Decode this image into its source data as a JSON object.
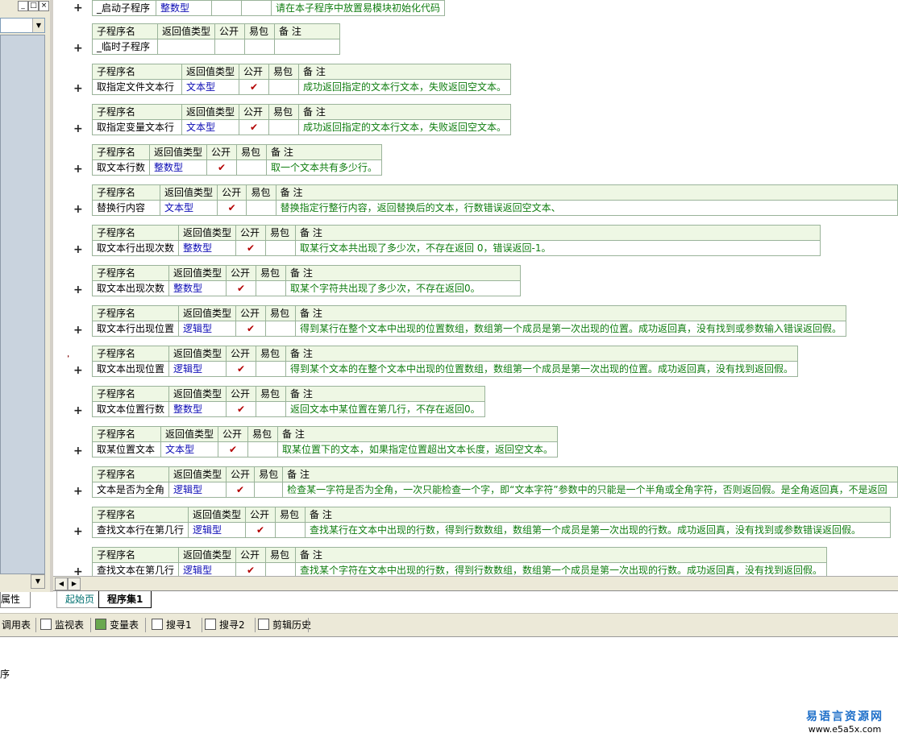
{
  "left_panel": {
    "btn_a": "_",
    "btn_b": "□",
    "btn_c": "×",
    "bottom_tab": "属性"
  },
  "top_row": {
    "name": "_启动子程序",
    "type": "整数型",
    "note": "请在本子程序中放置易模块初始化代码"
  },
  "headers": {
    "name": "子程序名",
    "type": "返回值类型",
    "public": "公开",
    "easy_pack": "易包",
    "note": "备 注"
  },
  "subroutines": [
    {
      "name": "_临时子程序",
      "type": "",
      "public": "",
      "note": ""
    },
    {
      "name": "取指定文件文本行",
      "type": "文本型",
      "public": "✔",
      "note": "成功返回指定的文本行文本，失败返回空文本。"
    },
    {
      "name": "取指定变量文本行",
      "type": "文本型",
      "public": "✔",
      "note": "成功返回指定的文本行文本，失败返回空文本。"
    },
    {
      "name": "取文本行数",
      "type": "整数型",
      "public": "✔",
      "note": "取一个文本共有多少行。"
    },
    {
      "name": "替换行内容",
      "type": "文本型",
      "public": "✔",
      "note": "替换指定行整行内容，返回替换后的文本，行数错误返回空文本、"
    },
    {
      "name": "取文本行出现次数",
      "type": "整数型",
      "public": "✔",
      "note": "取某行文本共出现了多少次，不存在返回 0，错误返回-1。"
    },
    {
      "name": "取文本出现次数",
      "type": "整数型",
      "public": "✔",
      "note": "取某个字符共出现了多少次，不存在返回0。"
    },
    {
      "name": "取文本行出现位置",
      "type": "逻辑型",
      "public": "✔",
      "note": "得到某行在整个文本中出现的位置数组，数组第一个成员是第一次出现的位置。成功返回真，没有找到或参数输入错误返回假。"
    },
    {
      "name": "取文本出现位置",
      "type": "逻辑型",
      "public": "✔",
      "note": "得到某个文本的在整个文本中出现的位置数组，数组第一个成员是第一次出现的位置。成功返回真，没有找到返回假。"
    },
    {
      "name": "取文本位置行数",
      "type": "整数型",
      "public": "✔",
      "note": "返回文本中某位置在第几行，不存在返回0。"
    },
    {
      "name": "取某位置文本",
      "type": "文本型",
      "public": "✔",
      "note": "取某位置下的文本，如果指定位置超出文本长度，返回空文本。"
    },
    {
      "name": "文本是否为全角",
      "type": "逻辑型",
      "public": "✔",
      "note": "检查某一字符是否为全角，一次只能检查一个字，即“文本字符”参数中的只能是一个半角或全角字符，否则返回假。是全角返回真，不是返回"
    },
    {
      "name": "查找文本行在第几行",
      "type": "逻辑型",
      "public": "✔",
      "note": "查找某行在文本中出现的行数，得到行数数组，数组第一个成员是第一次出现的行数。成功返回真，没有找到或参数错误返回假。"
    },
    {
      "name": "查找文本在第几行",
      "type": "逻辑型",
      "public": "✔",
      "note": "查找某个字符在文本中出现的行数，得到行数数组，数组第一个成员是第一次出现的行数。成功返回真，没有找到返回假。"
    }
  ],
  "tabs": {
    "home": "起始页",
    "set": "程序集1"
  },
  "toolbar": [
    {
      "label": "调用表",
      "icon": "call-table-icon"
    },
    {
      "label": "监视表",
      "icon": "magnifier-icon"
    },
    {
      "label": "变量表",
      "icon": "variable-icon"
    },
    {
      "label": "搜寻1",
      "icon": "search-list-icon"
    },
    {
      "label": "搜寻2",
      "icon": "search-list-icon"
    },
    {
      "label": "剪辑历史",
      "icon": "clipboard-icon"
    }
  ],
  "status_line": "序",
  "watermark": {
    "title": "易语言资源网",
    "url": "www.e5a5x.com"
  },
  "colors": {
    "header_bg": "#eef7e4",
    "type_text": "#0b0bb4",
    "note_text": "#0f7d0f",
    "check": "#b30000",
    "border": "#9ab39a"
  }
}
